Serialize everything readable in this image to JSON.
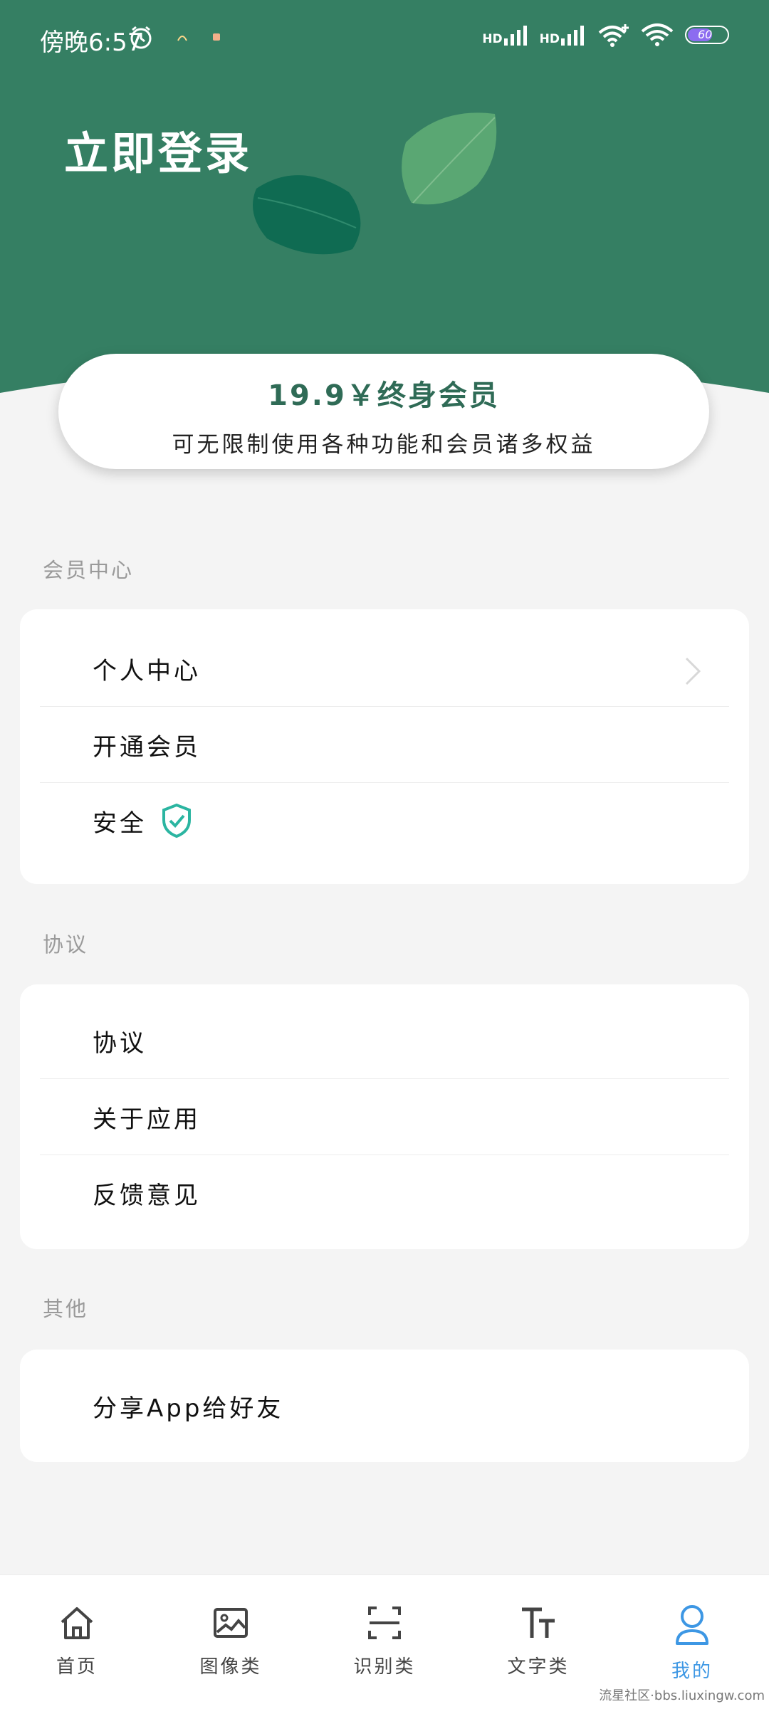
{
  "status_bar": {
    "time": "傍晚6:57",
    "signal_labels": [
      "HD",
      "HD"
    ],
    "battery": "60"
  },
  "header": {
    "login_label": "立即登录"
  },
  "promo": {
    "price_label": "19.9￥终身会员",
    "subtitle": "可无限制使用各种功能和会员诸多权益"
  },
  "sections": [
    {
      "title": "会员中心",
      "items": [
        {
          "label": "个人中心"
        },
        {
          "label": "开通会员"
        },
        {
          "label": "安全"
        }
      ]
    },
    {
      "title": "协议",
      "items": [
        {
          "label": "协议"
        },
        {
          "label": "关于应用"
        },
        {
          "label": "反馈意见"
        }
      ]
    },
    {
      "title": "其他",
      "items": [
        {
          "label": "分享App给好友"
        }
      ]
    }
  ],
  "tabbar": {
    "tabs": [
      {
        "label": "首页",
        "icon": "home-icon"
      },
      {
        "label": "图像类",
        "icon": "image-icon"
      },
      {
        "label": "识别类",
        "icon": "scan-icon"
      },
      {
        "label": "文字类",
        "icon": "text-icon"
      },
      {
        "label": "我的",
        "icon": "user-icon"
      }
    ],
    "active_color": "#3d97e4"
  },
  "watermark": "流星社区·bbs.liuxingw.com",
  "colors": {
    "header_green": "#357f63",
    "accent_green": "#2f6b56",
    "leaf_dark": "#0f6b52",
    "leaf_light": "#5aa773",
    "shield": "#2bb5a1"
  }
}
